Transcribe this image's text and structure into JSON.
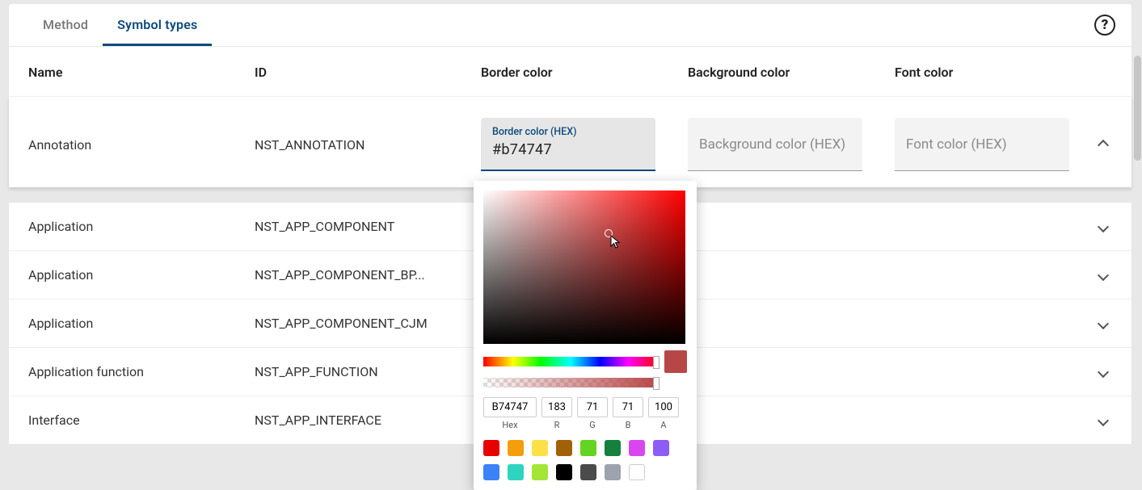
{
  "tabs": {
    "method": "Method",
    "symbol_types": "Symbol types"
  },
  "headers": {
    "name": "Name",
    "id": "ID",
    "border": "Border color",
    "bg": "Background color",
    "font": "Font color"
  },
  "row0": {
    "name": "Annotation",
    "id": "NST_ANNOTATION",
    "border_field": {
      "label": "Border color (HEX)",
      "value": "#b74747"
    },
    "bg_placeholder": "Background color (HEX)",
    "font_placeholder": "Font color (HEX)"
  },
  "rows": [
    {
      "name": "Application",
      "id": "NST_APP_COMPONENT"
    },
    {
      "name": "Application",
      "id": "NST_APP_COMPONENT_BP..."
    },
    {
      "name": "Application",
      "id": "NST_APP_COMPONENT_CJM"
    },
    {
      "name": "Application function",
      "id": "NST_APP_FUNCTION"
    },
    {
      "name": "Interface",
      "id": "NST_APP_INTERFACE"
    }
  ],
  "picker": {
    "hex": "B74747",
    "r": "183",
    "g": "71",
    "b": "71",
    "a": "100",
    "labels": {
      "hex": "Hex",
      "r": "R",
      "g": "G",
      "b": "B",
      "a": "A"
    },
    "current_color": "#b74747",
    "swatches": [
      "#e60000",
      "#f59e0b",
      "#fde047",
      "#a16207",
      "#65d321",
      "#15803d",
      "#d946ef",
      "#8b5cf6",
      "#3b82f6",
      "#2dd4bf",
      "#a3e635",
      "#000000",
      "#4b4b4b",
      "#9ca3af",
      "#ffffff"
    ]
  }
}
